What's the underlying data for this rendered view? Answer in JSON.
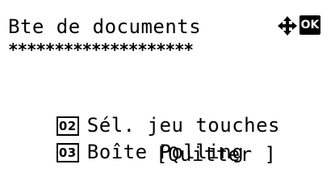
{
  "header": {
    "title": "Bte de documents",
    "nav_icon": "four-way-arrows-icon",
    "ok_label": "OK"
  },
  "separator": {
    "pattern": "********************"
  },
  "menu": {
    "items": [
      {
        "number": "02",
        "label": "Sél. jeu touches"
      },
      {
        "number": "03",
        "label": "Boîte Polling"
      }
    ]
  },
  "softkey": {
    "quit_label": "[Quitter ]"
  }
}
